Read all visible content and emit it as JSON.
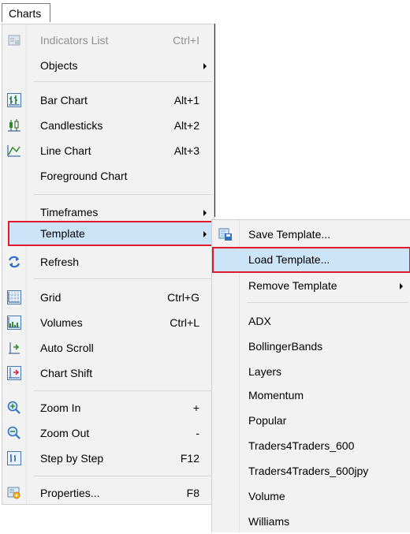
{
  "menubar": {
    "charts": "Charts"
  },
  "main_menu": {
    "indicators_list": {
      "label": "Indicators List",
      "shortcut": "Ctrl+I"
    },
    "objects": {
      "label": "Objects"
    },
    "bar_chart": {
      "label": "Bar Chart",
      "shortcut": "Alt+1"
    },
    "candlesticks": {
      "label": "Candlesticks",
      "shortcut": "Alt+2"
    },
    "line_chart": {
      "label": "Line Chart",
      "shortcut": "Alt+3"
    },
    "foreground_chart": {
      "label": "Foreground Chart"
    },
    "timeframes": {
      "label": "Timeframes"
    },
    "template": {
      "label": "Template"
    },
    "refresh": {
      "label": "Refresh"
    },
    "grid": {
      "label": "Grid",
      "shortcut": "Ctrl+G"
    },
    "volumes": {
      "label": "Volumes",
      "shortcut": "Ctrl+L"
    },
    "auto_scroll": {
      "label": "Auto Scroll"
    },
    "chart_shift": {
      "label": "Chart Shift"
    },
    "zoom_in": {
      "label": "Zoom In",
      "shortcut": "+"
    },
    "zoom_out": {
      "label": "Zoom Out",
      "shortcut": "-"
    },
    "step_by_step": {
      "label": "Step by Step",
      "shortcut": "F12"
    },
    "properties": {
      "label": "Properties...",
      "shortcut": "F8"
    }
  },
  "template_menu": {
    "save_template": {
      "label": "Save Template..."
    },
    "load_template": {
      "label": "Load Template..."
    },
    "remove_template": {
      "label": "Remove Template"
    },
    "templates": [
      "ADX",
      "BollingerBands",
      "Layers",
      "Momentum",
      "Popular",
      "Traders4Traders_600",
      "Traders4Traders_600jpy",
      "Volume",
      "Williams"
    ]
  },
  "colors": {
    "highlight_bg": "#cce4f7",
    "highlight_border": "#e0192c",
    "menu_bg": "#f2f2f2",
    "disabled_text": "#8f8f8f"
  }
}
